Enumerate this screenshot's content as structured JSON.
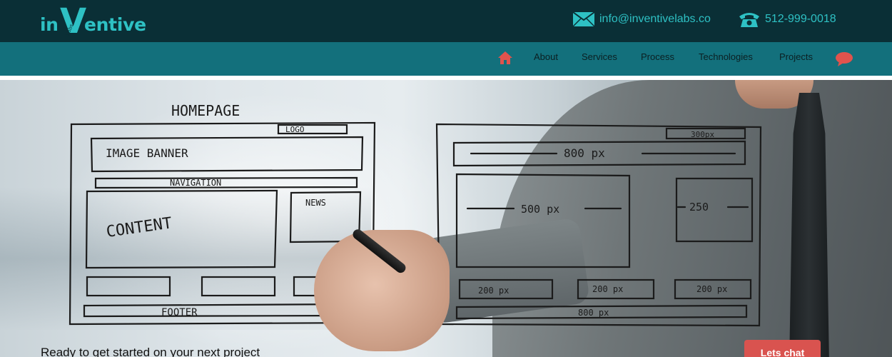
{
  "brand": {
    "logo_prefix": "in",
    "logo_v": "V",
    "logo_suffix": "entive",
    "logo_sub": "Labs",
    "accent_color": "#2ec1c4"
  },
  "contact": {
    "email_icon": "envelope-icon",
    "email": "info@inventivelabs.co",
    "phone_icon": "telephone-icon",
    "phone": "512-999-0018"
  },
  "nav": {
    "home_icon": "home-icon",
    "items": [
      {
        "label": "About"
      },
      {
        "label": "Services"
      },
      {
        "label": "Process"
      },
      {
        "label": "Technologies"
      },
      {
        "label": "Projects"
      }
    ],
    "chat_icon": "speech-bubble-icon"
  },
  "hero": {
    "sketch": {
      "title": "HOMEPAGE",
      "logo": "LOGO",
      "image_banner": "IMAGE BANNER",
      "navigation": "NAVIGATION",
      "content": "CONTENT",
      "news": "NEWS",
      "footer": "FOOTER",
      "w300": "300px",
      "w800": "800 px",
      "w500": "500 px",
      "w250": "250",
      "w200a": "200 px",
      "w200b": "200 px",
      "w200c": "200 px",
      "w800b": "800 px"
    },
    "tagline": "Ready to get started on your next project",
    "chat_button": "Lets chat"
  }
}
